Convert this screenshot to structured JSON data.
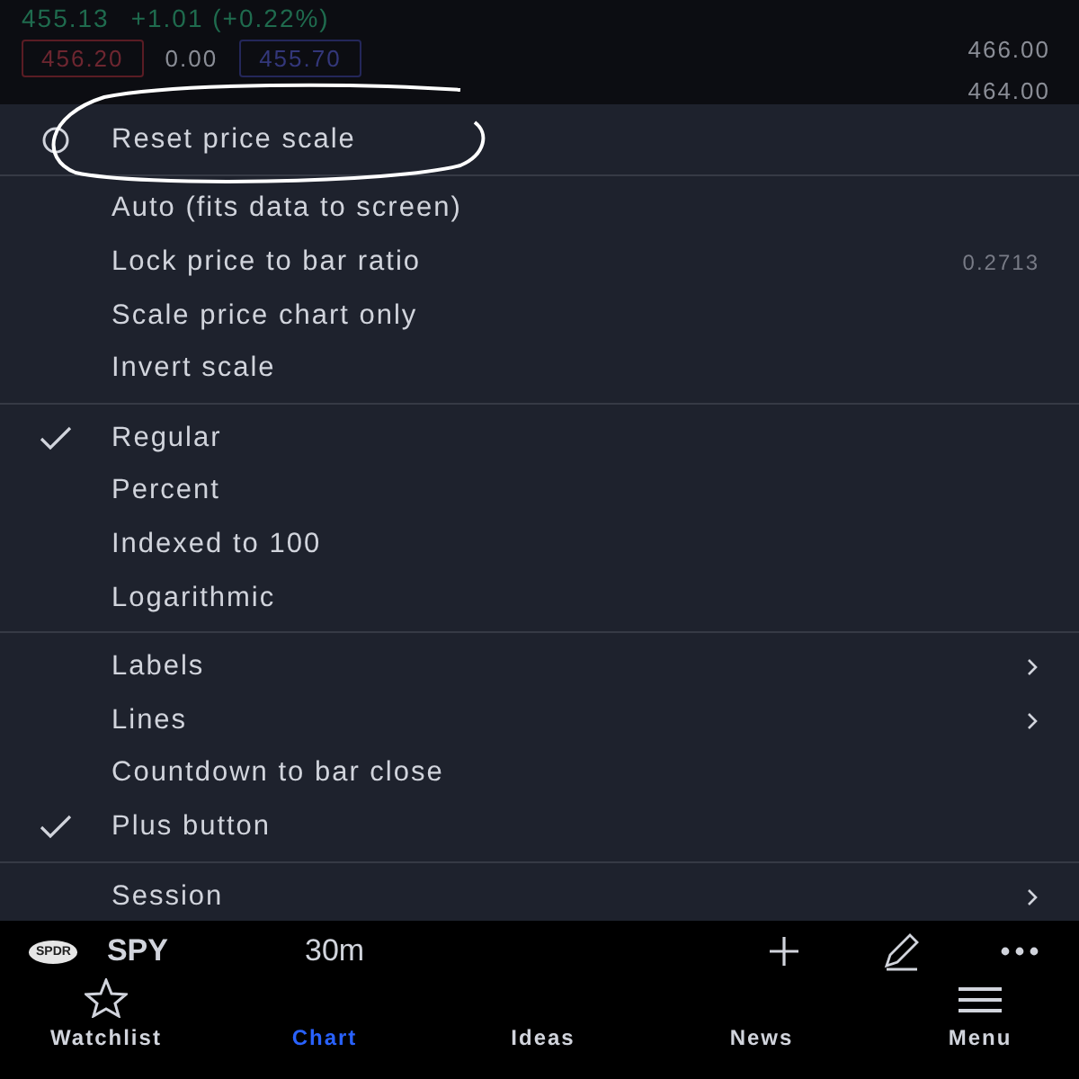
{
  "quote": {
    "price": "455.13",
    "change": "+1.01 (+0.22%)",
    "sell": "456.20",
    "spread": "0.00",
    "buy": "455.70"
  },
  "price_axis": [
    "466.00",
    "464.00"
  ],
  "menu": {
    "sections": [
      {
        "items": [
          {
            "label": "Reset price scale",
            "kind": "action"
          }
        ]
      },
      {
        "items": [
          {
            "label": "Auto (fits data to screen)",
            "kind": "option",
            "checked": false
          },
          {
            "label": "Lock price to bar ratio",
            "kind": "option",
            "checked": false,
            "value": "0.2713"
          },
          {
            "label": "Scale price chart only",
            "kind": "option",
            "checked": false
          },
          {
            "label": "Invert scale",
            "kind": "option",
            "checked": false
          }
        ]
      },
      {
        "items": [
          {
            "label": "Regular",
            "kind": "option",
            "checked": true
          },
          {
            "label": "Percent",
            "kind": "option",
            "checked": false
          },
          {
            "label": "Indexed to 100",
            "kind": "option",
            "checked": false
          },
          {
            "label": "Logarithmic",
            "kind": "option",
            "checked": false
          }
        ]
      },
      {
        "items": [
          {
            "label": "Labels",
            "kind": "submenu"
          },
          {
            "label": "Lines",
            "kind": "submenu"
          },
          {
            "label": "Countdown to bar close",
            "kind": "option",
            "checked": false
          },
          {
            "label": "Plus button",
            "kind": "option",
            "checked": true
          }
        ]
      },
      {
        "items": [
          {
            "label": "Session",
            "kind": "submenu"
          }
        ]
      }
    ]
  },
  "annotation": {
    "kind": "ellipse"
  },
  "toolbar": {
    "symbol_badge": "SPDR",
    "symbol": "SPY",
    "interval": "30m"
  },
  "tabs": [
    {
      "label": "Watchlist",
      "selected": false,
      "kind": "star"
    },
    {
      "label": "Chart",
      "selected": true,
      "kind": "none"
    },
    {
      "label": "Ideas",
      "selected": false,
      "kind": "none"
    },
    {
      "label": "News",
      "selected": false,
      "kind": "none"
    },
    {
      "label": "Menu",
      "selected": false,
      "kind": "lines"
    }
  ]
}
